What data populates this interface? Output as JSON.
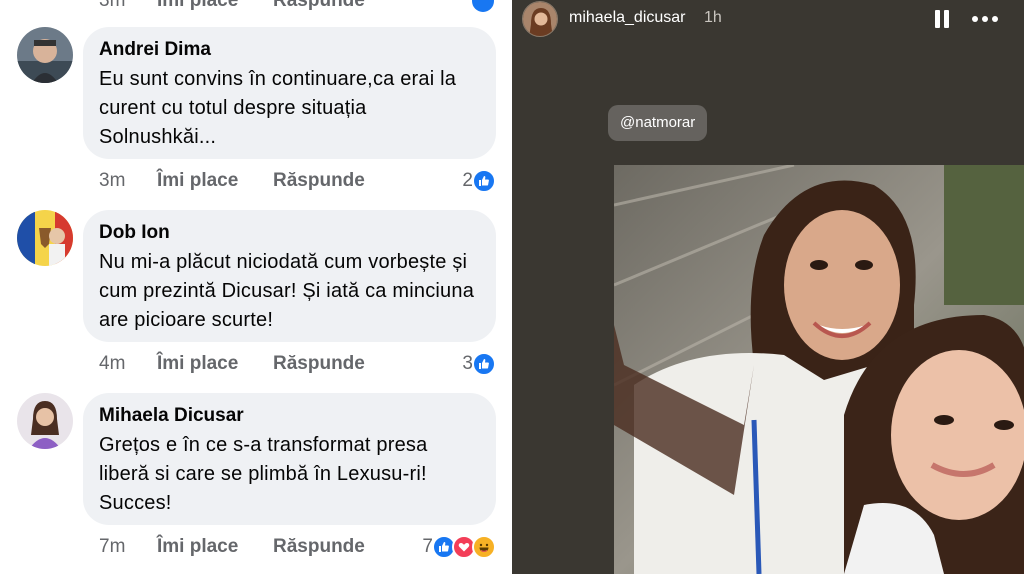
{
  "facebook": {
    "top_partial": {
      "time": "3m",
      "like_label": "Îmi place",
      "reply_label": "Răspunde"
    },
    "comments": [
      {
        "author": "Andrei Dima",
        "text": "Eu sunt convins în continuare,ca erai la curent cu totul despre situația Solnushkăi...",
        "time": "3m",
        "like_label": "Îmi place",
        "reply_label": "Răspunde",
        "reaction_count": "2",
        "reactions": [
          "like-icon"
        ]
      },
      {
        "author": "Dob Ion",
        "text": "Nu mi-a plăcut niciodată cum vorbește și cum prezintă Dicusar! Și iată ca minciuna are picioare scurte!",
        "time": "4m",
        "like_label": "Îmi place",
        "reply_label": "Răspunde",
        "reaction_count": "3",
        "reactions": [
          "like-icon"
        ]
      },
      {
        "author": "Mihaela Dicusar",
        "text": "Grețos e în ce s-a transformat presa liberă si care se plimbă în Lexusu-ri! Succes!",
        "time": "7m",
        "like_label": "Îmi place",
        "reply_label": "Răspunde",
        "reaction_count": "7",
        "reactions": [
          "like-icon",
          "love-icon",
          "haha-icon"
        ]
      }
    ],
    "colors": {
      "bubble": "#eff1f4",
      "like_blue": "#1877f2",
      "love_red": "#f33e58",
      "haha_yellow": "#f7b125",
      "meta_gray": "#65676b"
    }
  },
  "instagram": {
    "username": "mihaela_dicusar",
    "time": "1h",
    "mention": "@natmorar",
    "controls": [
      "pause-icon",
      "more-options-icon"
    ],
    "colors": {
      "background": "#3a3731"
    }
  }
}
